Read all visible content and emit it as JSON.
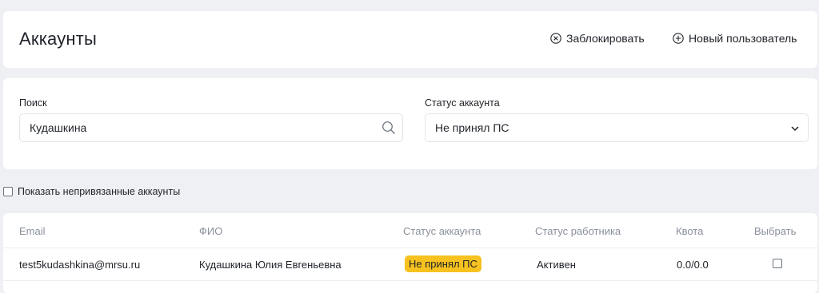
{
  "header": {
    "title": "Аккаунты",
    "block_label": "Заблокировать",
    "new_user_label": "Новый пользователь"
  },
  "filters": {
    "search_label": "Поиск",
    "search_value": "Кудашкина",
    "status_label": "Статус аккаунта",
    "status_value": "Не принял ПС"
  },
  "show_unlinked_label": "Показать непривязанные аккаунты",
  "table": {
    "columns": [
      "Email",
      "ФИО",
      "Статус аккаунта",
      "Статус работника",
      "Квота",
      "Выбрать"
    ],
    "rows": [
      {
        "email": "test5kudashkina@mrsu.ru",
        "fio": "Кудашкина Юлия Евгеньевна",
        "account_status": "Не принял ПС",
        "employee_status": "Активен",
        "quota": "0.0/0.0"
      }
    ]
  },
  "colors": {
    "background": "#eef0f3",
    "card": "#ffffff",
    "badge_warning": "#f7c21f",
    "muted_text": "#8a9099"
  },
  "icons": {
    "block": "circle-x-icon",
    "new_user": "circle-plus-icon",
    "search": "search-icon",
    "status_dropdown": "chevron-down-icon"
  }
}
